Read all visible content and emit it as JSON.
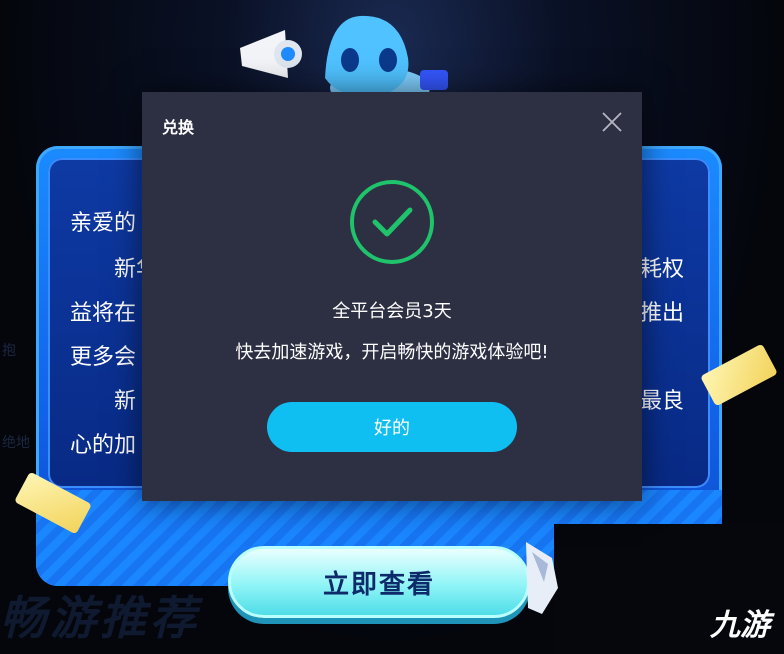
{
  "background": {
    "ghost_text": "畅游推荐",
    "side_texts": [
      "抱",
      "绝地"
    ]
  },
  "promo": {
    "lines": [
      "亲爱的",
      "新华",
      "耗权",
      "益将在",
      "推出",
      "更多会",
      "新",
      "最良",
      "心的加"
    ],
    "view_button_label": "立即查看"
  },
  "watermark": "九游",
  "modal": {
    "title": "兑换",
    "message_title": "全平台会员3天",
    "message_body": "快去加速游戏，开启畅快的游戏体验吧!",
    "ok_label": "好的"
  },
  "colors": {
    "modal_bg": "#2d2f42",
    "success_green": "#1fc36b",
    "ok_button": "#10bff2",
    "promo_blue": "#1b8bff"
  }
}
